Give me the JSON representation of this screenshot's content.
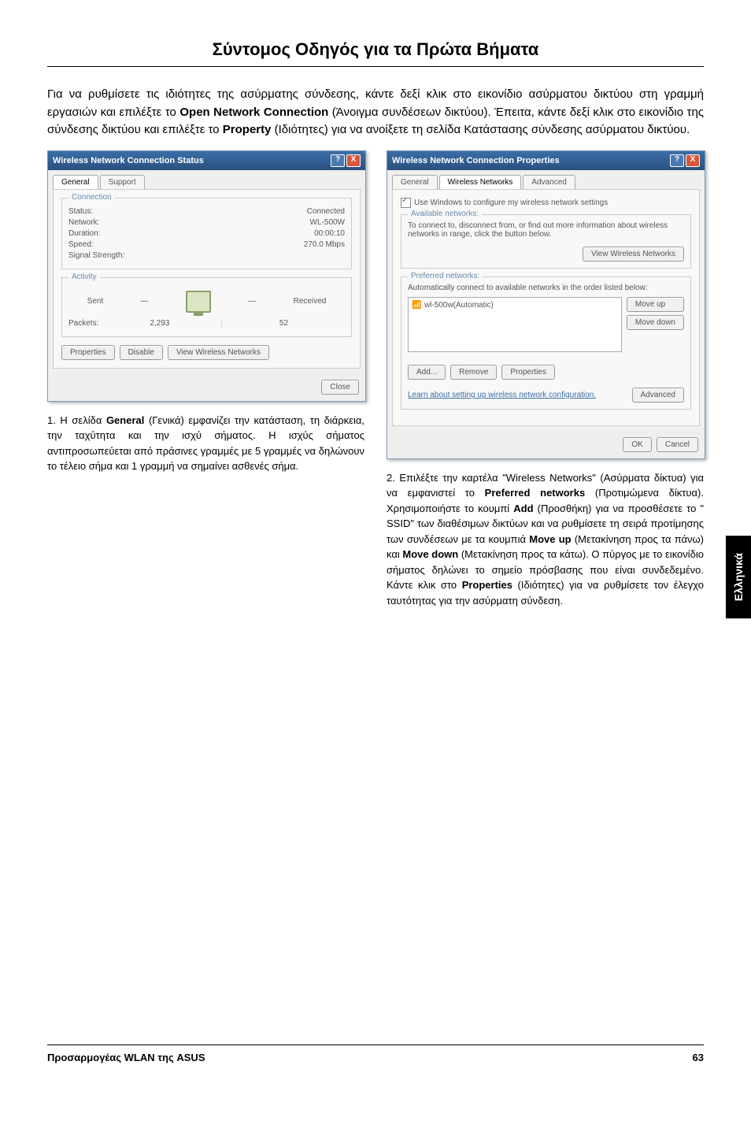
{
  "page_title": "Σύντομος Οδηγός για τα Πρώτα Βήματα",
  "intro_html": "Για να ρυθμίσετε τις ιδιότητες της ασύρματης σύνδεσης, κάντε δεξί κλικ στο εικονίδιο ασύρματου δικτύου στη γραμμή εργασιών και επιλέξτε το <b>Open Network Connection</b> (Άνοιγμα συνδέσεων δικτύου). Έπειτα, κάντε δεξί κλικ στο εικονίδιο της σύνδεσης δικτύου και επιλέξτε το <b>Property</b> (Ιδιότητες) για να ανοίξετε τη σελίδα Κατάστασης σύνδεσης ασύρματου δικτύου.",
  "dlg1": {
    "title": "Wireless Network Connection Status",
    "tab_general": "General",
    "tab_support": "Support",
    "grp_connection": "Connection",
    "lbl_status": "Status:",
    "val_status": "Connected",
    "lbl_network": "Network:",
    "val_network": "WL-500W",
    "lbl_duration": "Duration:",
    "val_duration": "00:00:10",
    "lbl_speed": "Speed:",
    "val_speed": "270.0 Mbps",
    "lbl_signal": "Signal Strength:",
    "grp_activity": "Activity",
    "lbl_sent": "Sent",
    "lbl_received": "Received",
    "lbl_packets": "Packets:",
    "val_sent": "2,293",
    "val_recv": "52",
    "btn_properties": "Properties",
    "btn_disable": "Disable",
    "btn_view": "View Wireless Networks",
    "btn_close": "Close"
  },
  "dlg2": {
    "title": "Wireless Network Connection Properties",
    "tab_general": "General",
    "tab_wireless": "Wireless Networks",
    "tab_advanced": "Advanced",
    "chk_usewin": "Use Windows to configure my wireless network settings",
    "grp_available": "Available networks:",
    "avail_text": "To connect to, disconnect from, or find out more information about wireless networks in range, click the button below.",
    "btn_viewnet": "View Wireless Networks",
    "grp_preferred": "Preferred networks:",
    "pref_text": "Automatically connect to available networks in the order listed below:",
    "list_item": "wl-500w(Automatic)",
    "btn_moveup": "Move up",
    "btn_movedown": "Move down",
    "btn_add": "Add...",
    "btn_remove": "Remove",
    "btn_props": "Properties",
    "learn_text": "Learn about setting up wireless network configuration.",
    "btn_advanced": "Advanced",
    "btn_ok": "OK",
    "btn_cancel": "Cancel"
  },
  "caption1_html": "1. Η σελίδα <b>General</b> (Γενικά) εμφανίζει την κατάσταση, τη διάρκεια, την ταχύτητα και την ισχύ σήματος. Η ισχύς σήματος αντιπροσωπεύεται από πράσινες γραμμές με 5 γραμμές να δηλώνουν το τέλειο σήμα και 1 γραμμή να σημαίνει ασθενές σήμα.",
  "caption2_html": "2. Επιλέξτε την καρτέλα \"Wireless Networks\" (Ασύρματα δίκτυα) για να εμφανιστεί το <b>Preferred networks</b> (Προτιμώμενα δίκτυα). Χρησιμοποιήστε το κουμπί <b>Add</b> (Προσθήκη) για να προσθέσετε το \" SSID\" των διαθέσιμων δικτύων και να ρυθμίσετε τη σειρά προτίμησης των συνδέσεων με τα κουμπιά <b>Move up</b> (Μετακίνηση προς τα πάνω) και <b>Move down</b> (Μετακίνηση προς τα κάτω). Ο πύργος με το εικονίδιο σήματος δηλώνει το σημείο πρόσβασης που είναι συνδεδεμένο. Κάντε κλικ στο <b>Properties</b> (Ιδιότητες) για να ρυθμίσετε τον έλεγχο ταυτότητας για την ασύρματη σύνδεση.",
  "side_tab": "Ελληνικά",
  "footer_title": "Προσαρμογέας WLAN της ASUS",
  "page_num": "63"
}
